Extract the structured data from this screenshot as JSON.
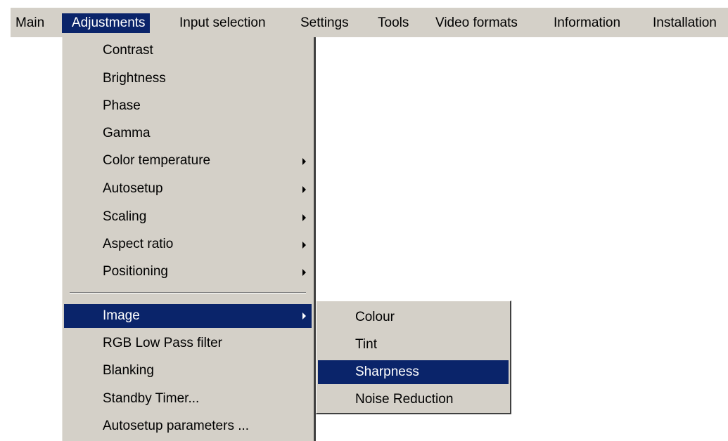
{
  "menubar": {
    "items": [
      {
        "label": "Main"
      },
      {
        "label": "Adjustments"
      },
      {
        "label": "Input selection"
      },
      {
        "label": "Settings"
      },
      {
        "label": "Tools"
      },
      {
        "label": "Video formats"
      },
      {
        "label": "Information"
      },
      {
        "label": "Installation"
      }
    ],
    "active": "Adjustments"
  },
  "adjustments_menu": {
    "items": [
      {
        "label": "Contrast"
      },
      {
        "label": "Brightness"
      },
      {
        "label": "Phase"
      },
      {
        "label": "Gamma"
      },
      {
        "label": "Color temperature",
        "submenu_arrow": "arrow-right-icon"
      },
      {
        "label": "Autosetup",
        "submenu_arrow": "arrow-right-icon"
      },
      {
        "label": "Scaling",
        "submenu_arrow": "arrow-right-icon"
      },
      {
        "label": "Aspect ratio",
        "submenu_arrow": "arrow-right-icon"
      },
      {
        "label": "Positioning",
        "submenu_arrow": "arrow-right-icon"
      },
      {
        "label": "Image",
        "submenu_arrow": "arrow-right-icon"
      },
      {
        "label": "RGB Low Pass filter"
      },
      {
        "label": "Blanking"
      },
      {
        "label": "Standby Timer..."
      },
      {
        "label": "Autosetup parameters ..."
      }
    ],
    "highlighted": "Image"
  },
  "image_submenu": {
    "items": [
      {
        "label": "Colour"
      },
      {
        "label": "Tint"
      },
      {
        "label": "Sharpness"
      },
      {
        "label": "Noise Reduction"
      }
    ],
    "highlighted": "Sharpness"
  },
  "colors": {
    "menu_background": "#d4d0c8",
    "highlight_background": "#0a246a",
    "highlight_text": "#ffffff"
  }
}
